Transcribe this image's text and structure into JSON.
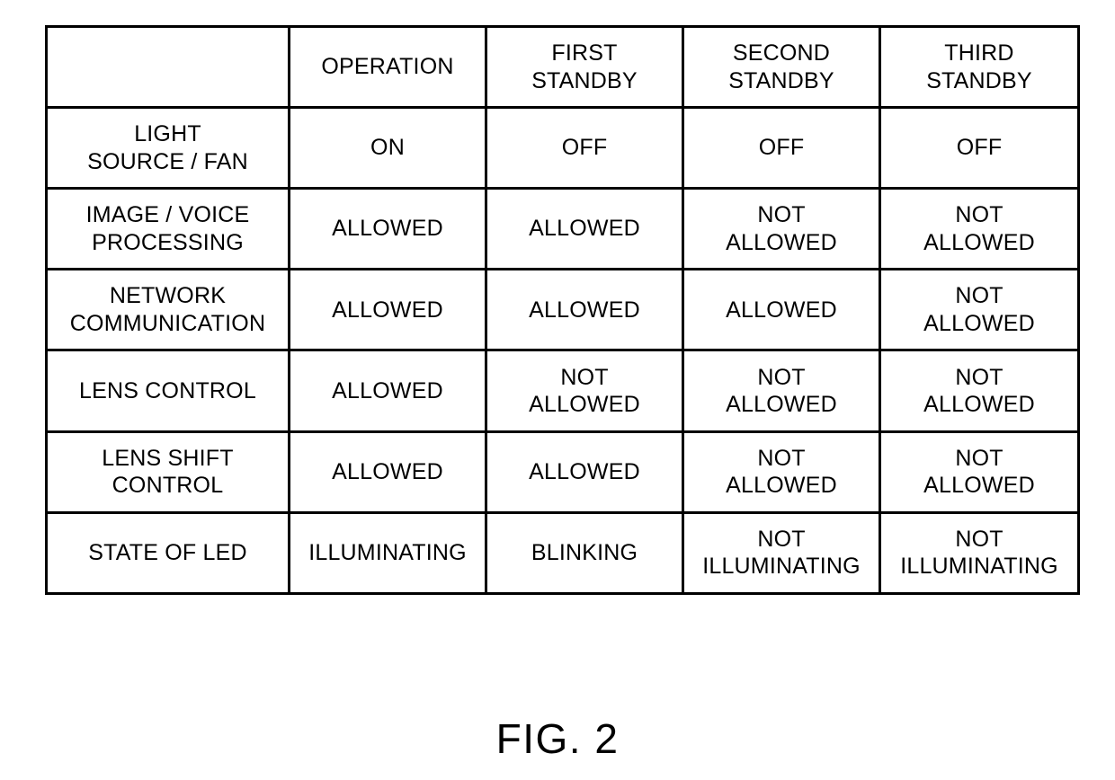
{
  "figure": {
    "caption": "FIG. 2"
  },
  "table": {
    "corner_label": "",
    "column_headers": [
      "OPERATION",
      "FIRST\nSTANDBY",
      "SECOND\nSTANDBY",
      "THIRD\nSTANDBY"
    ],
    "rows": [
      {
        "label": "LIGHT\nSOURCE / FAN",
        "cells": [
          "ON",
          "OFF",
          "OFF",
          "OFF"
        ]
      },
      {
        "label": "IMAGE / VOICE\nPROCESSING",
        "cells": [
          "ALLOWED",
          "ALLOWED",
          "NOT\nALLOWED",
          "NOT\nALLOWED"
        ]
      },
      {
        "label": "NETWORK\nCOMMUNICATION",
        "cells": [
          "ALLOWED",
          "ALLOWED",
          "ALLOWED",
          "NOT\nALLOWED"
        ]
      },
      {
        "label": "LENS CONTROL",
        "cells": [
          "ALLOWED",
          "NOT\nALLOWED",
          "NOT\nALLOWED",
          "NOT\nALLOWED"
        ]
      },
      {
        "label": "LENS SHIFT\nCONTROL",
        "cells": [
          "ALLOWED",
          "ALLOWED",
          "NOT\nALLOWED",
          "NOT\nALLOWED"
        ]
      },
      {
        "label": "STATE OF LED",
        "cells": [
          "ILLUMINATING",
          "BLINKING",
          "NOT\nILLUMINATING",
          "NOT\nILLUMINATING"
        ]
      }
    ]
  },
  "colors": {
    "background": "#ffffff",
    "line": "#000000",
    "text": "#000000"
  }
}
